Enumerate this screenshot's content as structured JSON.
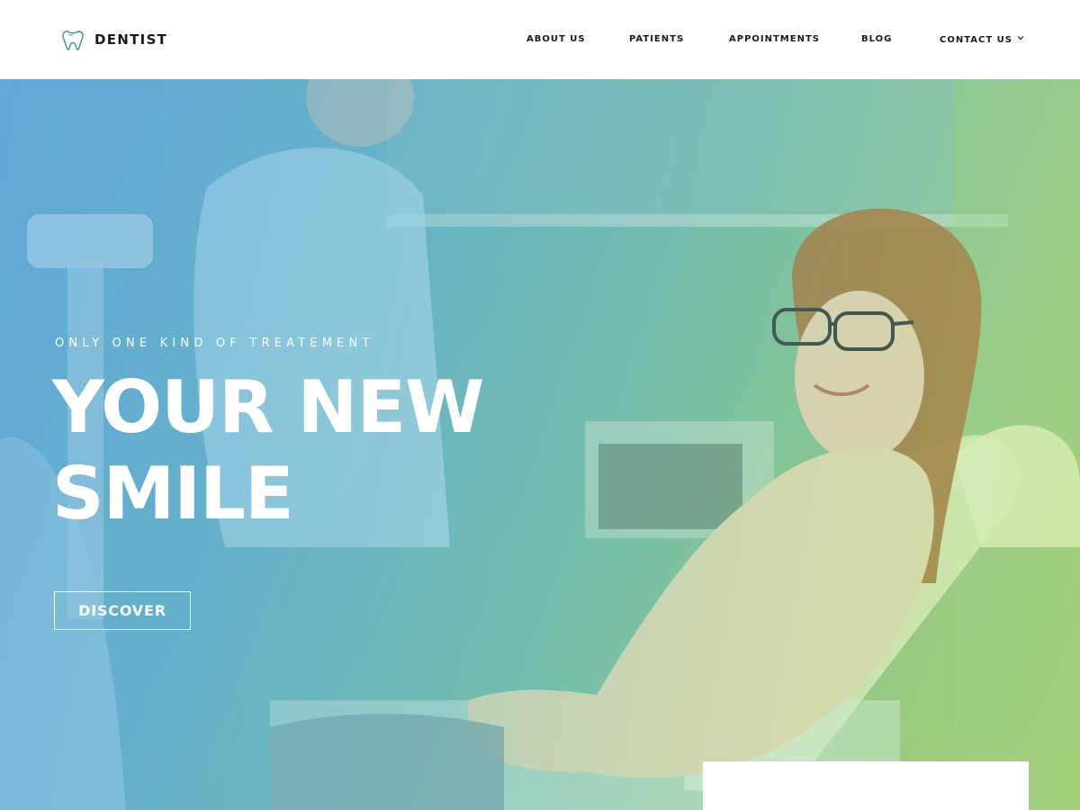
{
  "brand": {
    "name": "DENTIST",
    "icon": "tooth-icon"
  },
  "nav": {
    "about": "ABOUT US",
    "patients": "PATIENTS",
    "appointments": "APPOINTMENTS",
    "blog": "BLOG",
    "contact": "CONTACT US",
    "contact_icon": "chevron-down-icon"
  },
  "hero": {
    "eyebrow": "ONLY ONE KIND OF TREATEMENT",
    "headline_line1": "YOUR NEW",
    "headline_line2": "SMILE",
    "cta": "DISCOVER",
    "gradient_start": "#64a8d8",
    "gradient_end": "#a8cf72"
  },
  "colors": {
    "header_bg": "#ffffff",
    "text_dark": "#1a1a1a",
    "hero_text": "#ffffff"
  }
}
